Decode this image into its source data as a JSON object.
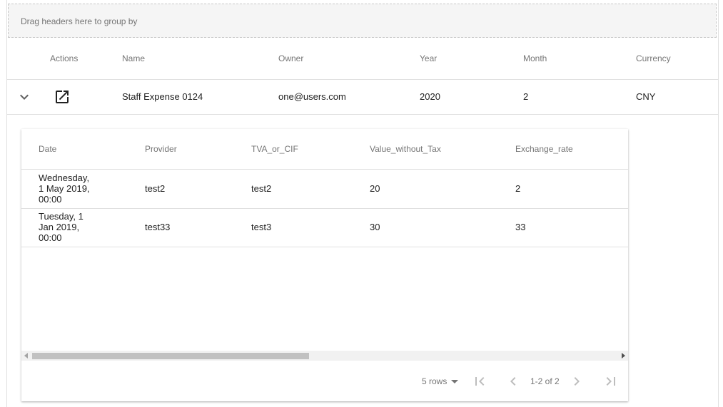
{
  "group_bar": {
    "text": "Drag headers here to group by"
  },
  "main_table": {
    "headers": {
      "actions": "Actions",
      "name": "Name",
      "owner": "Owner",
      "year": "Year",
      "month": "Month",
      "currency": "Currency"
    },
    "row": {
      "name": "Staff Expense 0124",
      "owner": "one@users.com",
      "year": "2020",
      "month": "2",
      "currency": "CNY"
    }
  },
  "detail_table": {
    "headers": {
      "date": "Date",
      "provider": "Provider",
      "tva": "TVA_or_CIF",
      "value": "Value_without_Tax",
      "rate": "Exchange_rate"
    },
    "rows": [
      {
        "date": "Wednesday, 1 May 2019, 00:00",
        "provider": "test2",
        "tva": "test2",
        "value": "20",
        "rate": "2"
      },
      {
        "date": "Tuesday, 1 Jan 2019, 00:00",
        "provider": "test33",
        "tva": "test3",
        "value": "30",
        "rate": "33"
      }
    ],
    "pagination": {
      "rows_per_page": "5 rows",
      "range": "1-2 of 2"
    }
  },
  "icons": {
    "expand": "chevron-down-icon",
    "open": "open-in-new-icon",
    "first": "first-page-icon",
    "prev": "chevron-left-icon",
    "next": "chevron-right-icon",
    "last": "last-page-icon"
  },
  "colors": {
    "header_text": "#757575",
    "border": "#e0e0e0",
    "group_bar_bg": "#f5f5f5"
  }
}
